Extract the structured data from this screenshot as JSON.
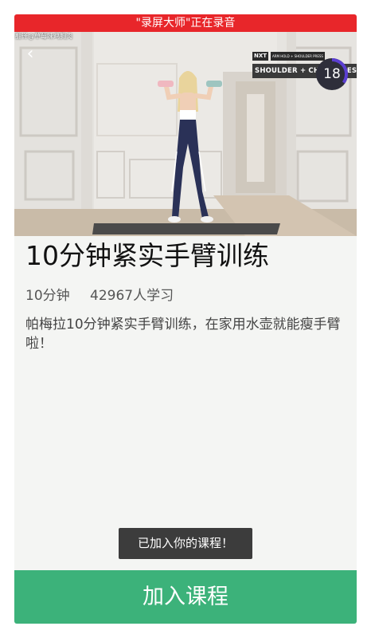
{
  "recording_banner": "\"录屏大师\"正在录音",
  "video": {
    "watermark": "翻译@草莓味鸡胸肉",
    "tag_brand": "NXT",
    "tag_subtitle": "ARM HOLD + SHOULDER PRESS",
    "tag_main": "SHOULDER + CHEST PRESS",
    "timer_value": "18",
    "timer_progress": 0.35
  },
  "course": {
    "title": "10分钟紧实手臂训练",
    "duration": "10分钟",
    "learners": "42967人学习",
    "description": "帕梅拉10分钟紧实手臂训练，在家用水壶就能瘦手臂啦！"
  },
  "toast": "已加入你的课程！",
  "join_button": "加入课程",
  "colors": {
    "recording_red": "#e8262a",
    "primary_green": "#3cb27a",
    "timer_accent": "#5b3fd1",
    "toast_bg": "#3c3c3c"
  },
  "icons": {
    "back": "chevron-left-icon"
  }
}
